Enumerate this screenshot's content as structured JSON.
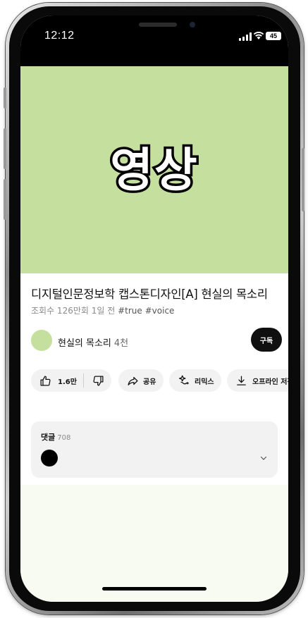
{
  "status_bar": {
    "time": "12:12",
    "battery": "45"
  },
  "video": {
    "placeholder_text": "영상",
    "background_color": "#c5e09e"
  },
  "details": {
    "title": "디지털인문정보학 캡스톤디자인[A] 현실의 목소리",
    "views": "조회수 126만회",
    "age": "1일 전",
    "tags": "#true #voice"
  },
  "channel": {
    "name": "현실의 목소리",
    "subscribers": "4천",
    "subscribe_label": "구독"
  },
  "actions": {
    "like_count": "1.6만",
    "share_label": "공유",
    "remix_label": "리믹스",
    "download_label": "오프라인 저장"
  },
  "comments": {
    "header": "댓글",
    "count": "708"
  },
  "colors": {
    "accent": "#c5e09e",
    "chip_background": "#f2f2f2",
    "subscribe_button": "#0f0f0f",
    "page_background": "#f7fbf1"
  },
  "icons": [
    "thumbs-up-icon",
    "thumbs-down-icon",
    "share-icon",
    "remix-icon",
    "download-icon",
    "chevron-down-icon",
    "signal-icon",
    "wifi-icon",
    "battery-icon"
  ]
}
